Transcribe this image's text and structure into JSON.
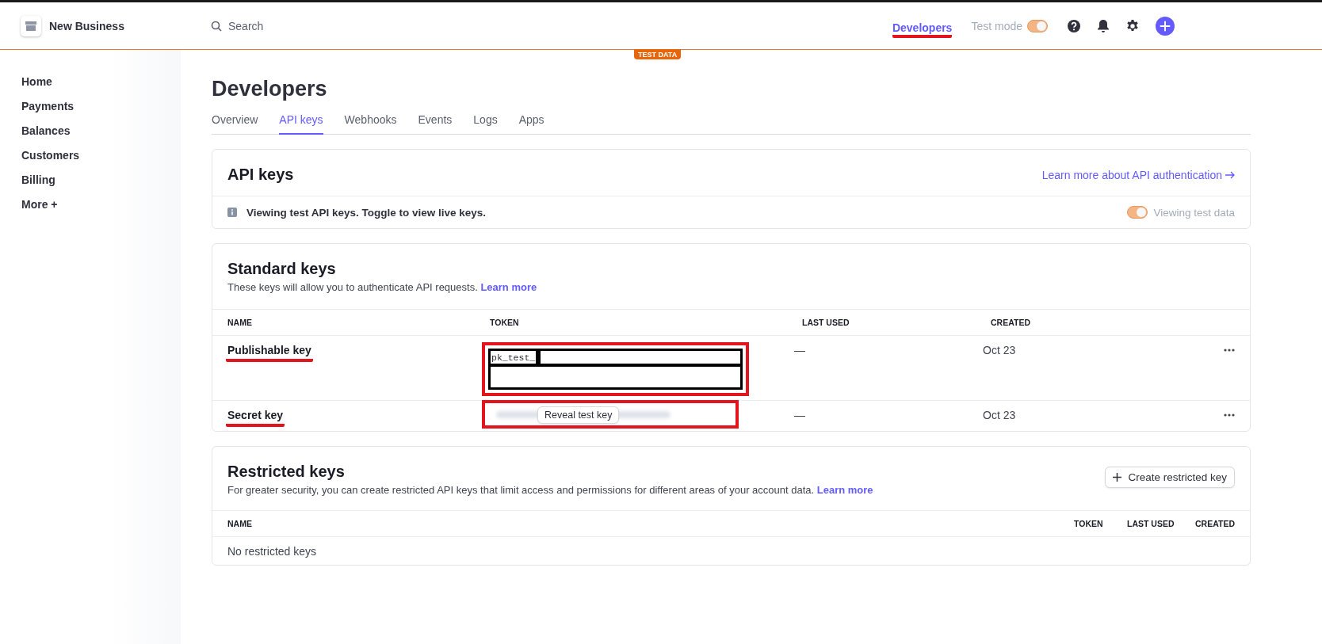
{
  "topbar": {
    "account": "New Business",
    "search_placeholder": "Search",
    "developers_link": {
      "label": "Developers",
      "highlighted": true
    },
    "test_mode": {
      "label": "Test mode",
      "on": true
    },
    "test_data_badge": "TEST DATA"
  },
  "sidebar": {
    "items": [
      {
        "label": "Home"
      },
      {
        "label": "Payments"
      },
      {
        "label": "Balances"
      },
      {
        "label": "Customers"
      },
      {
        "label": "Billing"
      },
      {
        "label": "More +"
      }
    ]
  },
  "page": {
    "title": "Developers",
    "tabs": [
      {
        "label": "Overview",
        "selected": false
      },
      {
        "label": "API keys",
        "selected": true
      },
      {
        "label": "Webhooks",
        "selected": false
      },
      {
        "label": "Events",
        "selected": false
      },
      {
        "label": "Logs",
        "selected": false
      },
      {
        "label": "Apps",
        "selected": false
      }
    ]
  },
  "api_keys_card": {
    "title": "API keys",
    "link": "Learn more about API authentication",
    "notice": "Viewing test API keys. Toggle to view live keys.",
    "toggle": {
      "label": "Viewing test data",
      "on": true
    }
  },
  "standard_keys": {
    "title": "Standard keys",
    "description": "These keys will allow you to authenticate API requests.",
    "link": "Learn more",
    "columns": [
      "NAME",
      "TOKEN",
      "LAST USED",
      "CREATED"
    ],
    "rows": [
      {
        "name": "Publishable key",
        "kind": "redacted",
        "token": "pk_test_",
        "last_used": "—",
        "created": "Oct 23",
        "highlighted": true
      },
      {
        "name": "Secret key",
        "kind": "hidden",
        "reveal_button": "Reveal test key",
        "last_used": "—",
        "created": "Oct 23",
        "highlighted": true
      }
    ]
  },
  "restricted_keys": {
    "title": "Restricted keys",
    "description": "For greater security, you can create restricted API keys that limit access and permissions for different areas of your account data.",
    "link": "Learn more",
    "button": "Create restricted key",
    "columns": [
      "NAME",
      "TOKEN",
      "LAST USED",
      "CREATED"
    ],
    "empty": "No restricted keys"
  }
}
